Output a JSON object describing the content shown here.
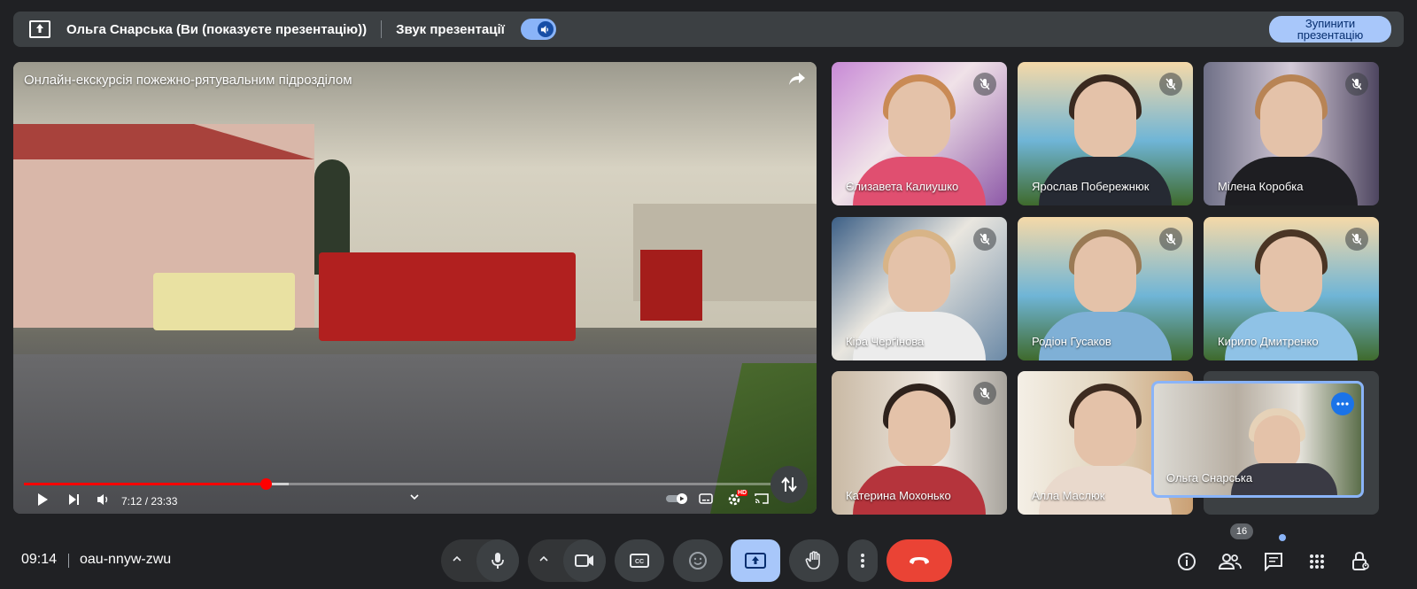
{
  "topbar": {
    "presenter_label": "Ольга Снарська (Ви (показуєте презентацію))",
    "sound_label": "Звук презентації",
    "stop_button": "Зупинити презентацію"
  },
  "video": {
    "title": "Онлайн-екскурсія пожежно-рятувальним підрозділом",
    "time": "7:12 / 23:33",
    "progress_played_fraction": 0.31,
    "progress_buffered_fraction": 0.34,
    "hd_badge": "HD"
  },
  "participants": [
    {
      "name": "Єлизавета Калиушко",
      "muted": true
    },
    {
      "name": "Ярослав Побережнюк",
      "muted": true
    },
    {
      "name": "Мілена Коробка",
      "muted": true
    },
    {
      "name": "Кіра Черґінова",
      "muted": true
    },
    {
      "name": "Родіон Гусаков",
      "muted": true
    },
    {
      "name": "Кирило Дмитренко",
      "muted": true
    },
    {
      "name": "Катерина Мохонько",
      "muted": true
    },
    {
      "name": "Алла Маслюк",
      "muted": false
    },
    {
      "name": "Ольга Снарська",
      "muted": false,
      "presenter": true
    }
  ],
  "bottombar": {
    "clock": "09:14",
    "meeting_code": "oau-nnyw-zwu",
    "people_count": "16"
  },
  "colors": {
    "background": "#202124",
    "panel": "#3c4043",
    "accent": "#8ab4f8",
    "end_call": "#ea4335",
    "progress": "#ff0000"
  }
}
